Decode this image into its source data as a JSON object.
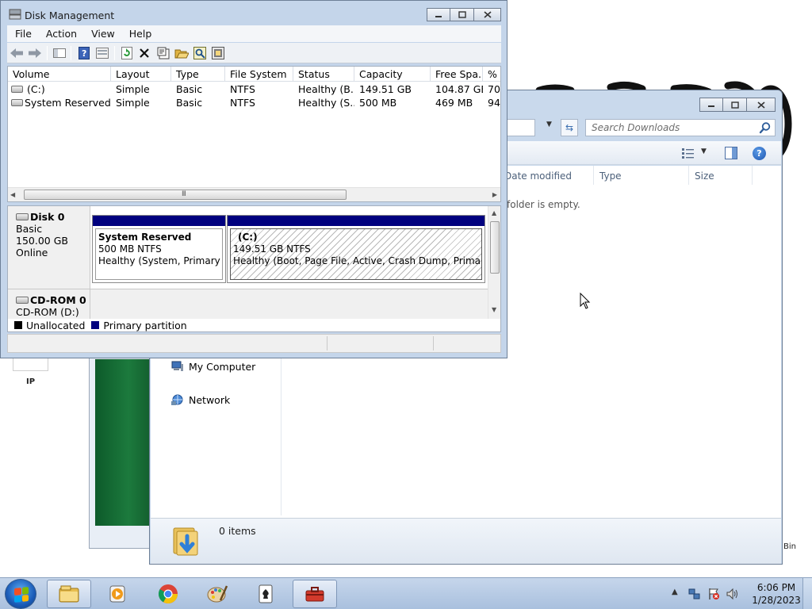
{
  "colors": {
    "primary_partition": "#00007e",
    "unallocated": "#000000",
    "taskbar": "#b8cce4",
    "window_frame": "#c4d5ea"
  },
  "desktop": {
    "ip_label": "IP",
    "bin_label": "Bin"
  },
  "disk_management": {
    "title": "Disk Management",
    "title_icon": "disk-management-icon",
    "menu": [
      "File",
      "Action",
      "View",
      "Help"
    ],
    "toolbar_icons": [
      "back-icon",
      "forward-icon",
      "show-hide-console-tree-icon",
      "help-icon",
      "properties-view-icon",
      "refresh-icon",
      "delete-icon",
      "properties-icon",
      "open-icon",
      "explore-icon",
      "rescan-icon"
    ],
    "volume_list": {
      "columns": [
        "Volume",
        "Layout",
        "Type",
        "File System",
        "Status",
        "Capacity",
        "Free Spa...",
        "% F"
      ],
      "rows": [
        [
          "(C:)",
          "Simple",
          "Basic",
          "NTFS",
          "Healthy (B...",
          "149.51 GB",
          "104.87 GB",
          "70"
        ],
        [
          "System Reserved",
          "Simple",
          "Basic",
          "NTFS",
          "Healthy (S...",
          "500 MB",
          "469 MB",
          "94"
        ]
      ],
      "scroll_grip": "III"
    },
    "disks": [
      {
        "name": "Disk 0",
        "type": "Basic",
        "size": "150.00 GB",
        "state": "Online",
        "partitions": [
          {
            "name": "System Reserved",
            "size": "500 MB NTFS",
            "status": "Healthy (System, Primary Par"
          },
          {
            "name": "(C:)",
            "size": "149.51 GB NTFS",
            "status": "Healthy (Boot, Page File, Active, Crash Dump, Primary Parti"
          }
        ]
      },
      {
        "name": "CD-ROM 0",
        "device": "CD-ROM (D:)"
      }
    ],
    "legend": [
      {
        "label": "Unallocated",
        "color": "#000000"
      },
      {
        "label": "Primary partition",
        "color": "#00007e"
      }
    ]
  },
  "explorer": {
    "search_placeholder": "Search Downloads",
    "columns": [
      "Date modified",
      "Type",
      "Size"
    ],
    "empty_message": "folder is empty.",
    "nav": [
      {
        "label": "My Computer",
        "icon": "computer-icon"
      },
      {
        "label": "Network",
        "icon": "network-icon"
      }
    ],
    "status": "0 items"
  },
  "taskbar": {
    "apps": [
      "windows-explorer-icon",
      "media-player-icon",
      "chrome-icon",
      "paint-icon",
      "solitaire-icon",
      "toolbox-icon"
    ],
    "tray_icons": [
      "show-hidden-icons-arrow",
      "network-tray-icon",
      "action-center-icon",
      "volume-icon"
    ],
    "clock_time": "6:06 PM",
    "clock_date": "1/28/2023"
  }
}
